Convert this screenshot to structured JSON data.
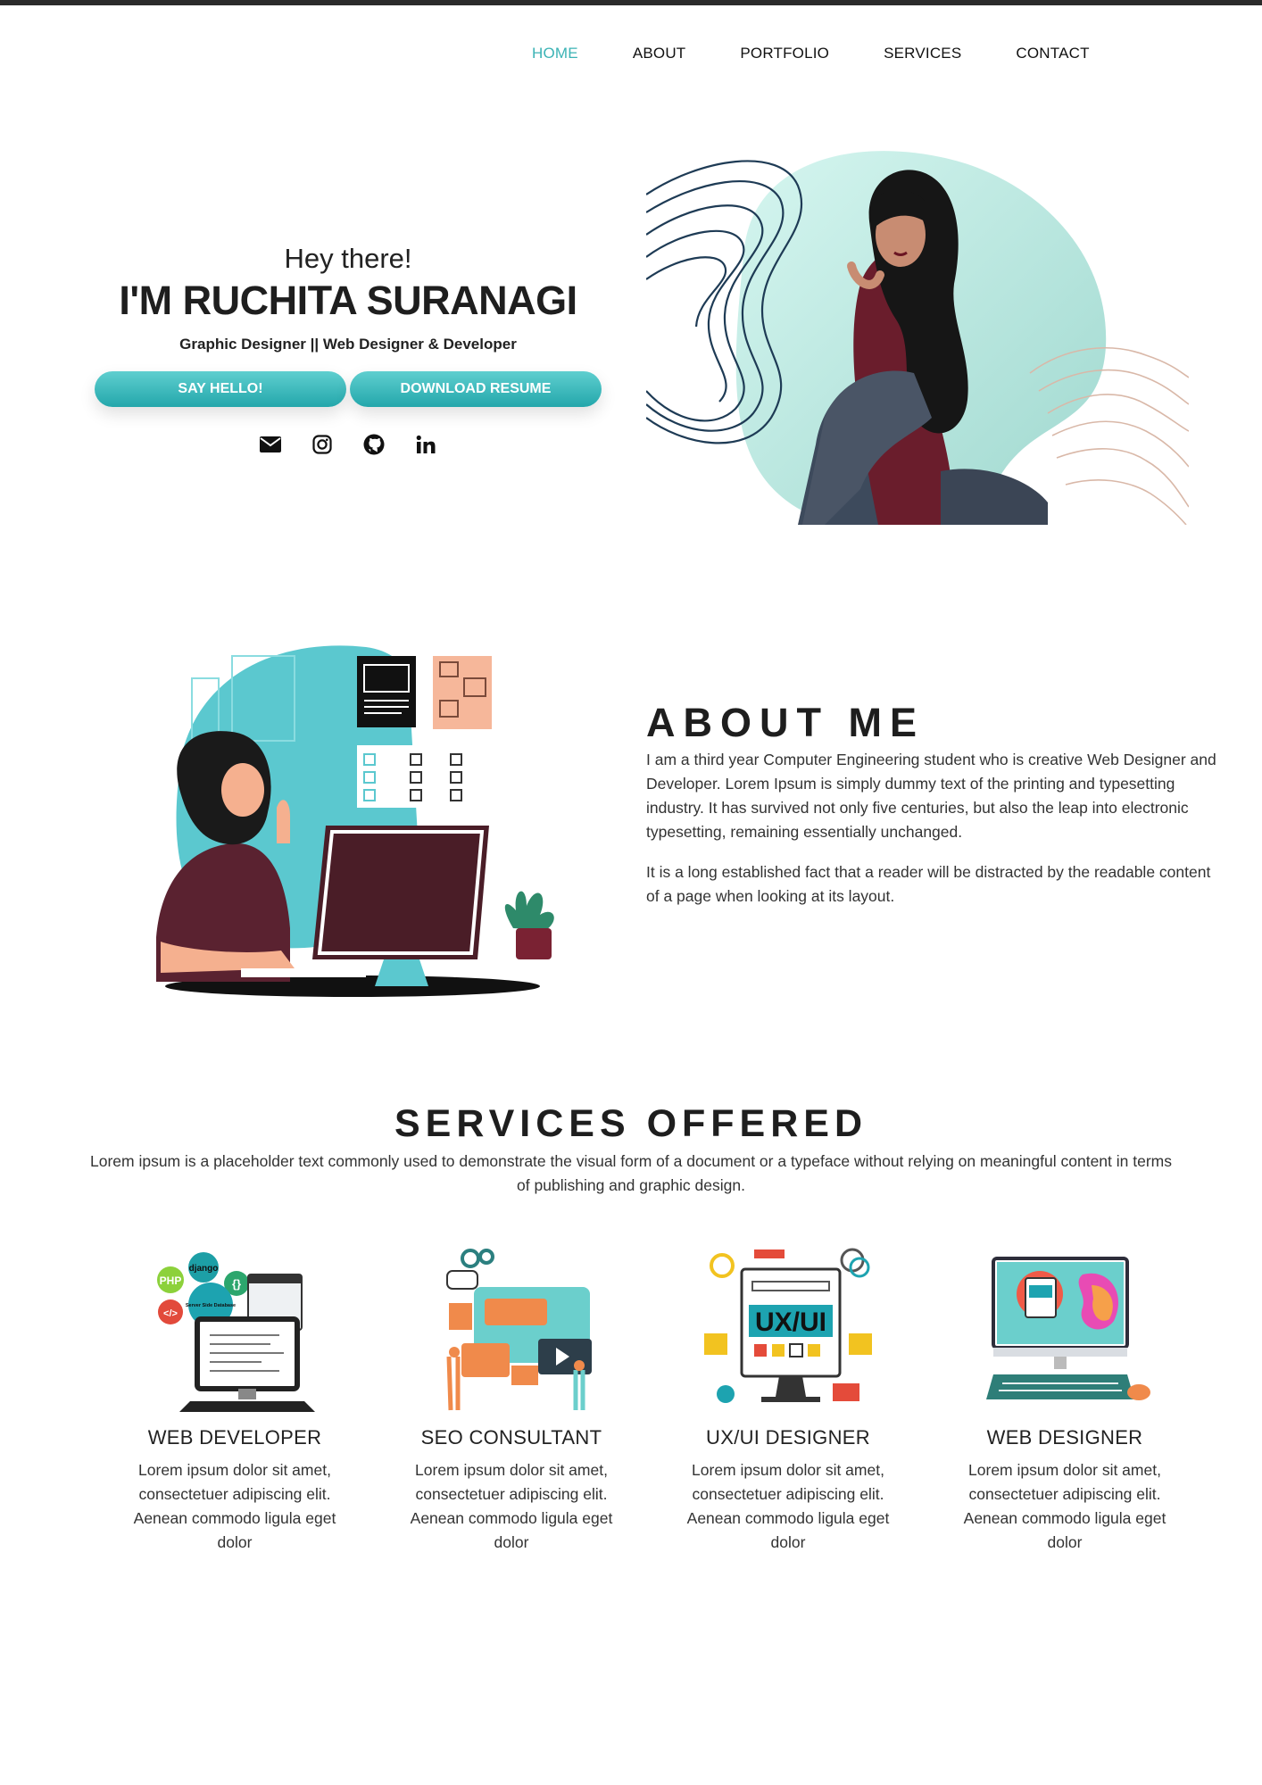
{
  "nav": {
    "items": [
      {
        "label": "HOME",
        "active": true
      },
      {
        "label": "ABOUT",
        "active": false
      },
      {
        "label": "PORTFOLIO",
        "active": false
      },
      {
        "label": "SERVICES",
        "active": false
      },
      {
        "label": "CONTACT",
        "active": false
      }
    ]
  },
  "hero": {
    "greeting": "Hey there!",
    "name": "I'M RUCHITA SURANAGI",
    "tagline": "Graphic Designer || Web Designer & Developer",
    "primary_button": "SAY HELLO!",
    "secondary_button": "DOWNLOAD RESUME",
    "socials": [
      "envelope-icon",
      "instagram-icon",
      "github-icon",
      "linkedin-icon"
    ]
  },
  "about": {
    "title": "ABOUT ME",
    "paragraphs": [
      "I am a third year Computer Engineering student who is creative Web Designer and Developer. Lorem Ipsum is simply dummy text of the printing and typesetting industry. It has survived not only five centuries, but also the leap into electronic typesetting, remaining essentially unchanged.",
      "It is a long established fact that a reader will be distracted by the readable content of a page when looking at its layout."
    ]
  },
  "services": {
    "title": "SERVICES OFFERED",
    "description": "Lorem ipsum is a placeholder text commonly used to demonstrate the visual form of a document or a typeface without relying on meaningful content in terms of publishing and graphic design.",
    "items": [
      {
        "title": "WEB DEVELOPER",
        "text": "Lorem ipsum dolor sit amet, consectetuer adipiscing elit. Aenean commodo ligula eget dolor",
        "icon_labels": [
          "PHP",
          "django",
          "Server Side Database"
        ]
      },
      {
        "title": "SEO CONSULTANT",
        "text": "Lorem ipsum dolor sit amet, consectetuer adipiscing elit. Aenean commodo ligula eget dolor"
      },
      {
        "title": "UX/UI DESIGNER",
        "text": "Lorem ipsum dolor sit amet, consectetuer adipiscing elit. Aenean commodo ligula eget dolor",
        "icon_labels": [
          "UX/UI"
        ]
      },
      {
        "title": "WEB DESIGNER",
        "text": "Lorem ipsum dolor sit amet, consectetuer adipiscing elit. Aenean commodo ligula eget dolor"
      }
    ]
  },
  "colors": {
    "accent": "#3bb3b5",
    "button_gradient_top": "#5fcfcf",
    "button_gradient_bottom": "#23a7ab",
    "maroon": "#5a1f2b",
    "blob": "#bfeee6"
  }
}
